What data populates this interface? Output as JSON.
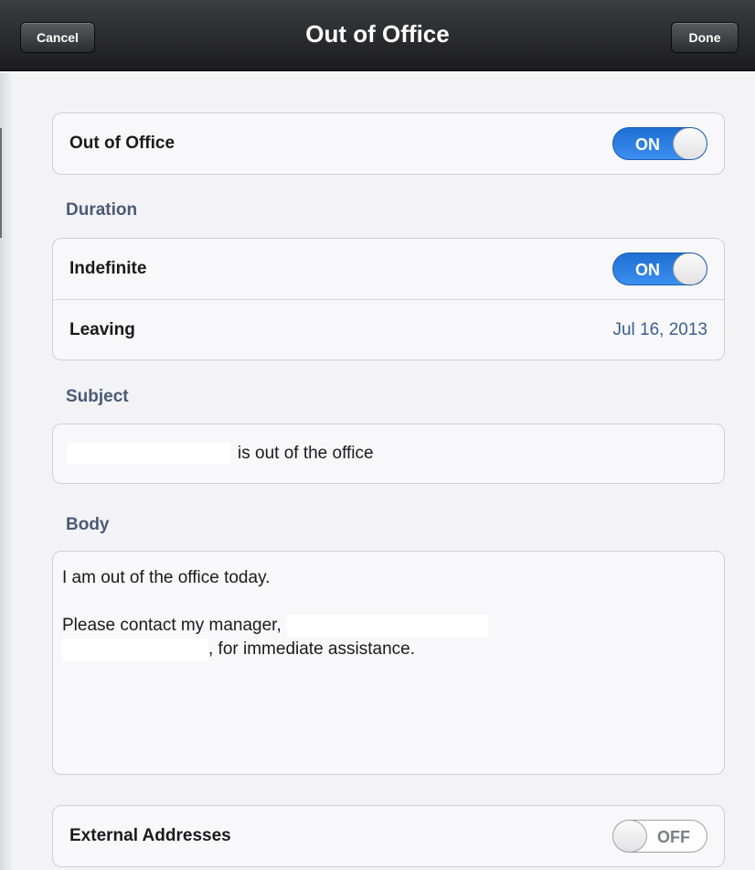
{
  "nav": {
    "title": "Out of Office",
    "cancel_label": "Cancel",
    "done_label": "Done"
  },
  "out_of_office": {
    "label": "Out of Office",
    "toggle": "ON"
  },
  "duration": {
    "header": "Duration",
    "indefinite_label": "Indefinite",
    "indefinite_toggle": "ON",
    "leaving_label": "Leaving",
    "leaving_value": "Jul 16, 2013"
  },
  "subject": {
    "header": "Subject",
    "text": "is out of the office"
  },
  "body": {
    "header": "Body",
    "line1": "I am out of the office today.",
    "line2": "Please contact my manager,",
    "line3": ", for immediate assistance."
  },
  "external": {
    "label": "External Addresses",
    "toggle": "OFF"
  },
  "colors": {
    "accent_blue": "#2a7de1",
    "value_blue": "#3b5f8f",
    "section_header": "#4c5a77",
    "nav_bar": "#1c1c1e"
  }
}
